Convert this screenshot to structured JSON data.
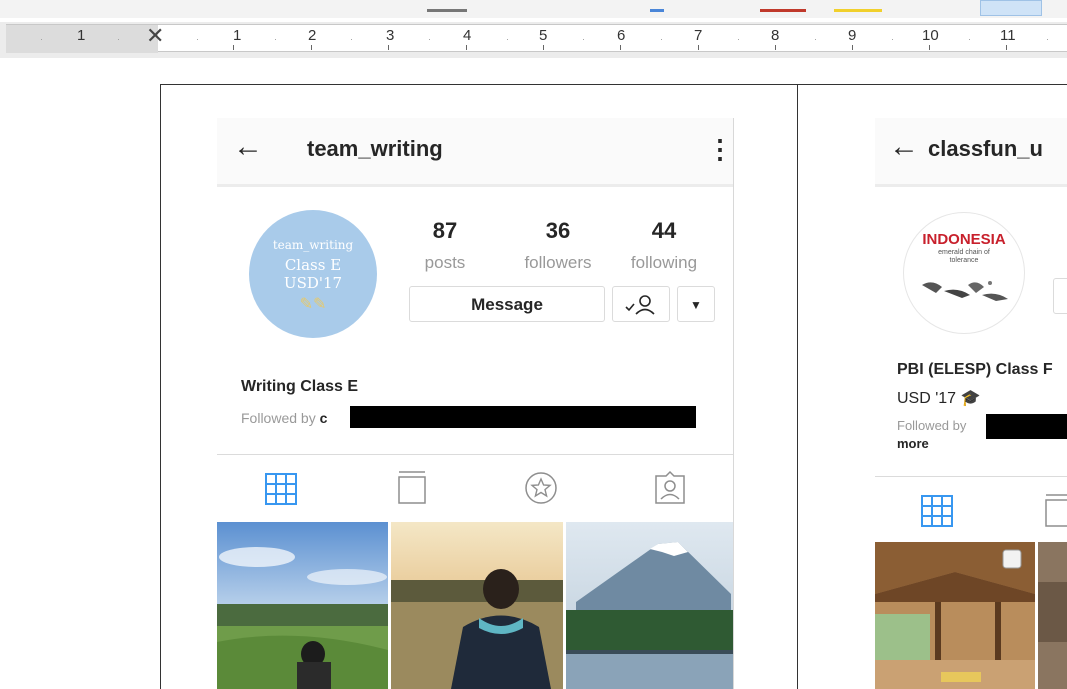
{
  "ruler": {
    "marks": [
      "1",
      "1",
      "2",
      "3",
      "4",
      "5",
      "6",
      "7",
      "8",
      "9",
      "10",
      "11"
    ]
  },
  "screenshot_1": {
    "username": "team_writing",
    "avatar": {
      "line1": "team_writing",
      "line2": "Class E",
      "line3": "USD'17"
    },
    "stats": [
      {
        "value": "87",
        "label": "posts"
      },
      {
        "value": "36",
        "label": "followers"
      },
      {
        "value": "44",
        "label": "following"
      }
    ],
    "message_button": "Message",
    "bio_name": "Writing Class E",
    "followed_by_prefix": "Followed by",
    "followed_by_visible": "c",
    "tabs": [
      "grid-icon",
      "igtv-icon",
      "star-icon",
      "tagged-icon"
    ],
    "accent_color": "#3897f0"
  },
  "screenshot_2": {
    "username": "classfun_u",
    "avatar": {
      "title": "INDONESIA",
      "subtitle_1": "emerald chain of",
      "subtitle_2": "tolerance"
    },
    "bio_line1": "PBI (ELESP) Class F",
    "bio_line2": "USD '17",
    "followed_by_prefix": "Followed by",
    "more": "more",
    "tabs": [
      "grid-icon",
      "igtv-icon"
    ]
  }
}
